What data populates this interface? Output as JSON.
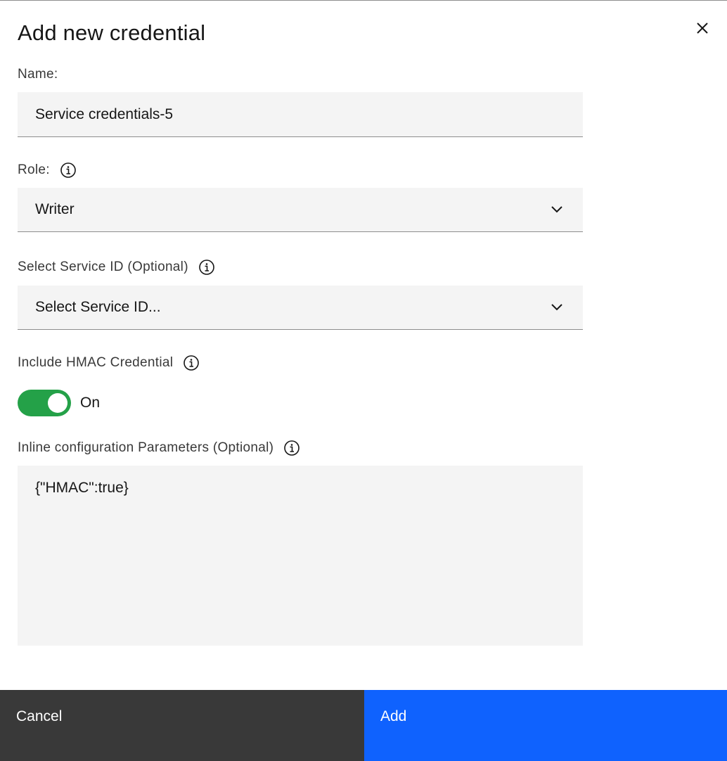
{
  "modal": {
    "title": "Add new credential",
    "close_icon": "close-icon"
  },
  "name": {
    "label": "Name:",
    "value": "Service credentials-5"
  },
  "role": {
    "label": "Role:",
    "info_icon": "info-icon",
    "selected": "Writer",
    "chevron_icon": "chevron-down-icon"
  },
  "service_id": {
    "label": "Select Service ID (Optional)",
    "info_icon": "info-icon",
    "placeholder": "Select Service ID...",
    "chevron_icon": "chevron-down-icon"
  },
  "hmac": {
    "label": "Include HMAC Credential",
    "info_icon": "info-icon",
    "toggle_state": "On",
    "toggle_on": true
  },
  "inline_config": {
    "label": "Inline configuration Parameters (Optional)",
    "info_icon": "info-icon",
    "value": "{\"HMAC\":true}"
  },
  "footer": {
    "cancel_label": "Cancel",
    "add_label": "Add"
  },
  "colors": {
    "toggle_on": "#24a148",
    "primary_button": "#0f62fe",
    "secondary_button": "#393939",
    "field_background": "#f4f4f4"
  }
}
